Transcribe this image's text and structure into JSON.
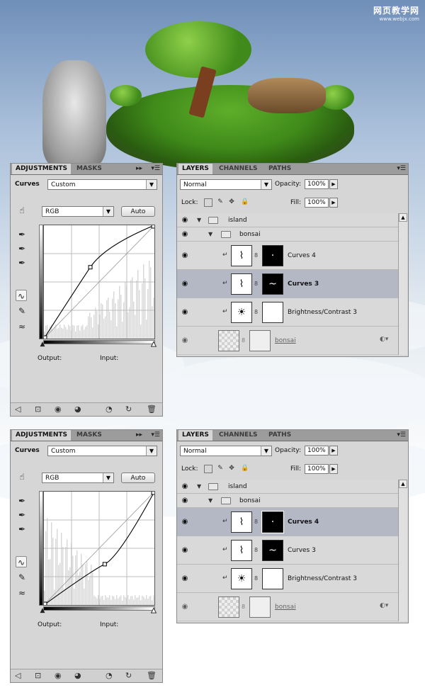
{
  "watermark": {
    "line1": "网页教学网",
    "line2": "www.webjx.com"
  },
  "screens": [
    {
      "adjustments": {
        "tabs": [
          "ADJUSTMENTS",
          "MASKS"
        ],
        "title": "Curves",
        "preset": "Custom",
        "channel": "RGB",
        "auto_label": "Auto",
        "output_label": "Output:",
        "input_label": "Input:",
        "curve_type": "lighten"
      },
      "layers": {
        "tabs": [
          "LAYERS",
          "CHANNELS",
          "PATHS"
        ],
        "blend_mode": "Normal",
        "opacity_label": "Opacity:",
        "opacity_value": "100%",
        "lock_label": "Lock:",
        "fill_label": "Fill:",
        "fill_value": "100%",
        "items": [
          {
            "name": "island",
            "kind": "group"
          },
          {
            "name": "bonsai",
            "kind": "group"
          },
          {
            "name": "Curves 4",
            "kind": "adjustment",
            "selected": false
          },
          {
            "name": "Curves 3",
            "kind": "adjustment",
            "selected": true
          },
          {
            "name": "Brightness/Contrast 3",
            "kind": "adjustment",
            "selected": false
          },
          {
            "name": "bonsai",
            "kind": "layer"
          }
        ]
      }
    },
    {
      "adjustments": {
        "tabs": [
          "ADJUSTMENTS",
          "MASKS"
        ],
        "title": "Curves",
        "preset": "Custom",
        "channel": "RGB",
        "auto_label": "Auto",
        "output_label": "Output:",
        "input_label": "Input:",
        "curve_type": "darken"
      },
      "layers": {
        "tabs": [
          "LAYERS",
          "CHANNELS",
          "PATHS"
        ],
        "blend_mode": "Normal",
        "opacity_label": "Opacity:",
        "opacity_value": "100%",
        "lock_label": "Lock:",
        "fill_label": "Fill:",
        "fill_value": "100%",
        "items": [
          {
            "name": "island",
            "kind": "group"
          },
          {
            "name": "bonsai",
            "kind": "group"
          },
          {
            "name": "Curves 4",
            "kind": "adjustment",
            "selected": true
          },
          {
            "name": "Curves 3",
            "kind": "adjustment",
            "selected": false
          },
          {
            "name": "Brightness/Contrast 3",
            "kind": "adjustment",
            "selected": false
          },
          {
            "name": "bonsai",
            "kind": "layer"
          }
        ]
      }
    }
  ],
  "colors": {
    "panel_bg": "#d6d6d6",
    "selected_row": "#b3b8c4",
    "tab_bar": "#9c9c9c"
  }
}
